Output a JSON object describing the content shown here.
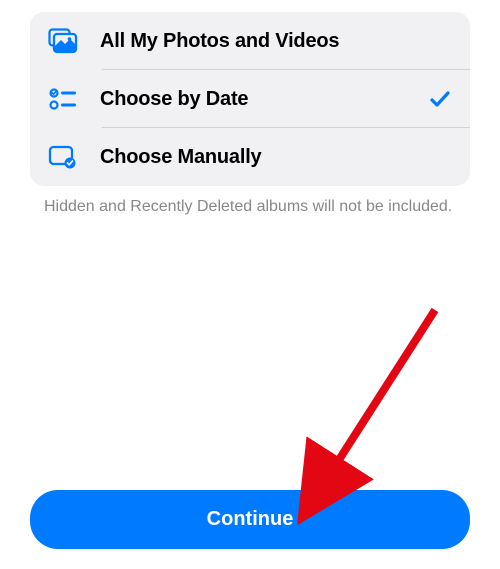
{
  "options": {
    "all_photos": {
      "label": "All My Photos and Videos",
      "selected": false
    },
    "by_date": {
      "label": "Choose by Date",
      "selected": true
    },
    "manually": {
      "label": "Choose Manually",
      "selected": false
    }
  },
  "helper_text": "Hidden and Recently Deleted albums will not be included.",
  "continue_label": "Continue",
  "colors": {
    "accent": "#007aff"
  }
}
